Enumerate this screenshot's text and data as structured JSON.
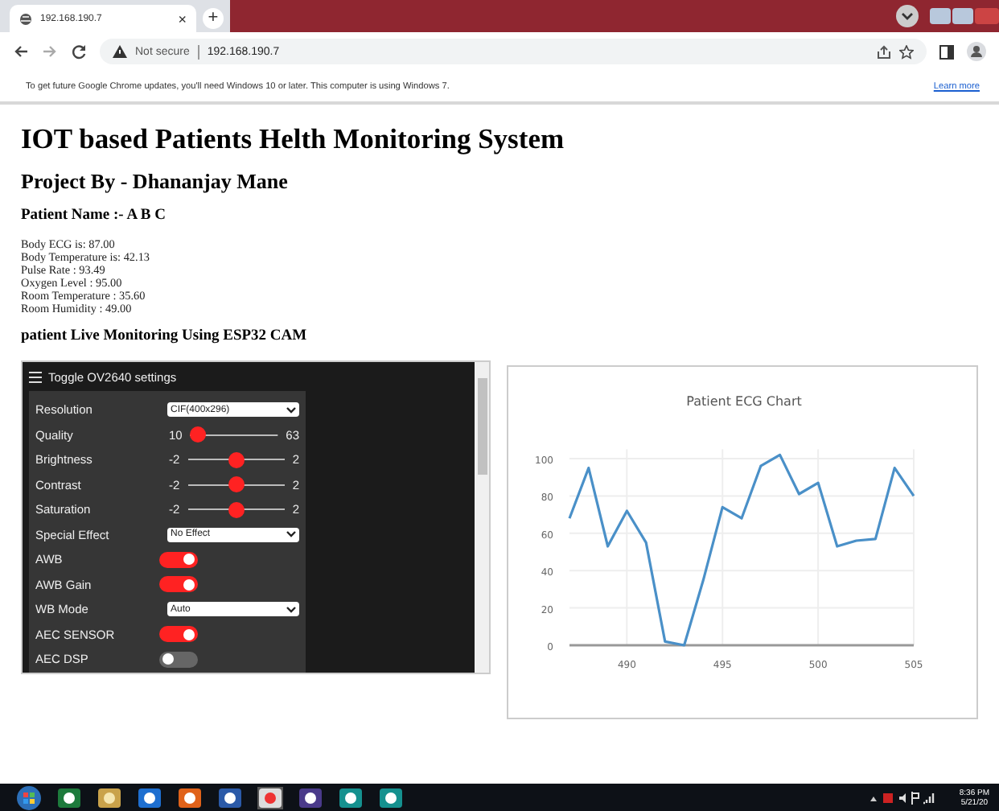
{
  "browser": {
    "tab_title": "192.168.190.7",
    "tab_close": "×",
    "new_tab": "+",
    "security": "Not secure",
    "url": "192.168.190.7",
    "infobar": {
      "message": "To get future Google Chrome updates, you'll need Windows 10 or later. This computer is using Windows 7.",
      "link": "Learn more"
    }
  },
  "page": {
    "title": "IOT based Patients Helth Monitoring System",
    "subtitle": "Project By - Dhananjay Mane",
    "patient": "Patient Name :- A B C",
    "readings": [
      "Body ECG is: 87.00",
      "Body Temperature is: 42.13",
      "Pulse Rate : 93.49",
      "Oxygen Level : 95.00",
      "Room Temperature : 35.60",
      "Room Humidity : 49.00"
    ],
    "camera_heading": "patient Live Monitoring Using ESP32 CAM"
  },
  "camera_settings": {
    "toggle_label": "Toggle OV2640 settings",
    "settings": [
      {
        "kind": "select",
        "label": "Resolution",
        "value": "CIF(400x296)"
      },
      {
        "kind": "range",
        "label": "Quality",
        "min": "10",
        "max": "63",
        "level": 0
      },
      {
        "kind": "range",
        "label": "Brightness",
        "min": "-2",
        "max": "2",
        "level": 0.5
      },
      {
        "kind": "range",
        "label": "Contrast",
        "min": "-2",
        "max": "2",
        "level": 0.5
      },
      {
        "kind": "range",
        "label": "Saturation",
        "min": "-2",
        "max": "2",
        "level": 0.5
      },
      {
        "kind": "select",
        "label": "Special Effect",
        "value": "No Effect"
      },
      {
        "kind": "toggle",
        "label": "AWB",
        "on": true
      },
      {
        "kind": "toggle",
        "label": "AWB Gain",
        "on": true
      },
      {
        "kind": "select",
        "label": "WB Mode",
        "value": "Auto"
      },
      {
        "kind": "toggle",
        "label": "AEC SENSOR",
        "on": true
      },
      {
        "kind": "toggle",
        "label": "AEC DSP",
        "on": false
      }
    ]
  },
  "ecg_chart": {
    "chart_data": {
      "type": "line",
      "title": "Patient ECG Chart",
      "x": [
        487,
        488,
        489,
        490,
        491,
        492,
        493,
        494,
        495,
        496,
        497,
        498,
        499,
        500,
        501,
        502,
        503,
        504,
        505
      ],
      "series": [
        {
          "color": "#4a90c8",
          "values": [
            68,
            95,
            53,
            72,
            55,
            2,
            0,
            35,
            74,
            68,
            96,
            102,
            81,
            87,
            53,
            56,
            57,
            95,
            80
          ]
        }
      ],
      "xlim": [
        487,
        505
      ],
      "ylim": [
        0,
        105
      ],
      "grid": true,
      "xticks": [
        490,
        495,
        500,
        505
      ],
      "yticks": [
        0,
        20,
        40,
        60,
        80,
        100
      ]
    }
  },
  "taskbar": {
    "time": "8:36 PM",
    "date": "5/21/20"
  }
}
